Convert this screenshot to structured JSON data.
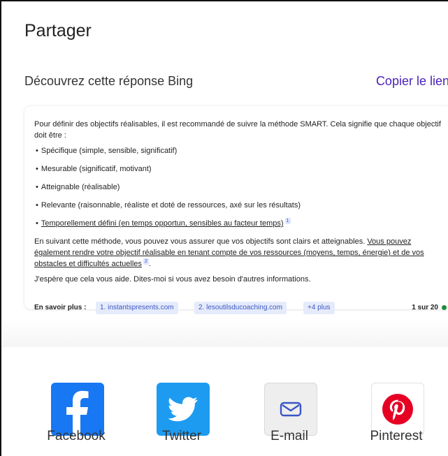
{
  "title": "Partager",
  "subtitle": "Découvrez cette réponse Bing",
  "copy_link": "Copier le lien",
  "card": {
    "intro": "Pour définir des objectifs réalisables, il est recommandé de suivre la méthode SMART. Cela signifie que chaque objectif doit être :",
    "bullets": [
      "Spécifique (simple, sensible, significatif)",
      "Mesurable (significatif, motivant)",
      "Atteignable (réalisable)",
      "Relevante (raisonnable, réaliste et doté de ressources, axé sur les résultats)",
      "Temporellement défini (en temps opportun, sensibles au facteur temps)"
    ],
    "bullet_cite": "1",
    "para2_a": "En suivant cette méthode, vous pouvez vous assurer que vos objectifs sont clairs et atteignables. ",
    "para2_b": "Vous pouvez également rendre votre objectif réalisable en tenant compte de vos ressources (moyens, temps, énergie) et de vos obstacles et difficultés actuelles",
    "para2_cite": "2",
    "para2_end": ".",
    "para3": "J'espère que cela vous aide. Dites-moi si vous avez besoin d'autres informations.",
    "sources_label": "En savoir plus :",
    "sources": [
      "1. instantspresents.com",
      "2. lesoutilsducoaching.com",
      "+4 plus"
    ],
    "counter": "1 sur 20",
    "counter_dot_color": "#1f8a3a"
  },
  "share": [
    {
      "label": "Facebook",
      "icon": "facebook-icon",
      "color": "#1877f2"
    },
    {
      "label": "Twitter",
      "icon": "twitter-icon",
      "color": "#1d9bf0"
    },
    {
      "label": "E-mail",
      "icon": "mail-icon",
      "color": "#eeeeee"
    },
    {
      "label": "Pinterest",
      "icon": "pinterest-icon",
      "color": "#e60023"
    }
  ],
  "accent_color": "#4a1fb8"
}
